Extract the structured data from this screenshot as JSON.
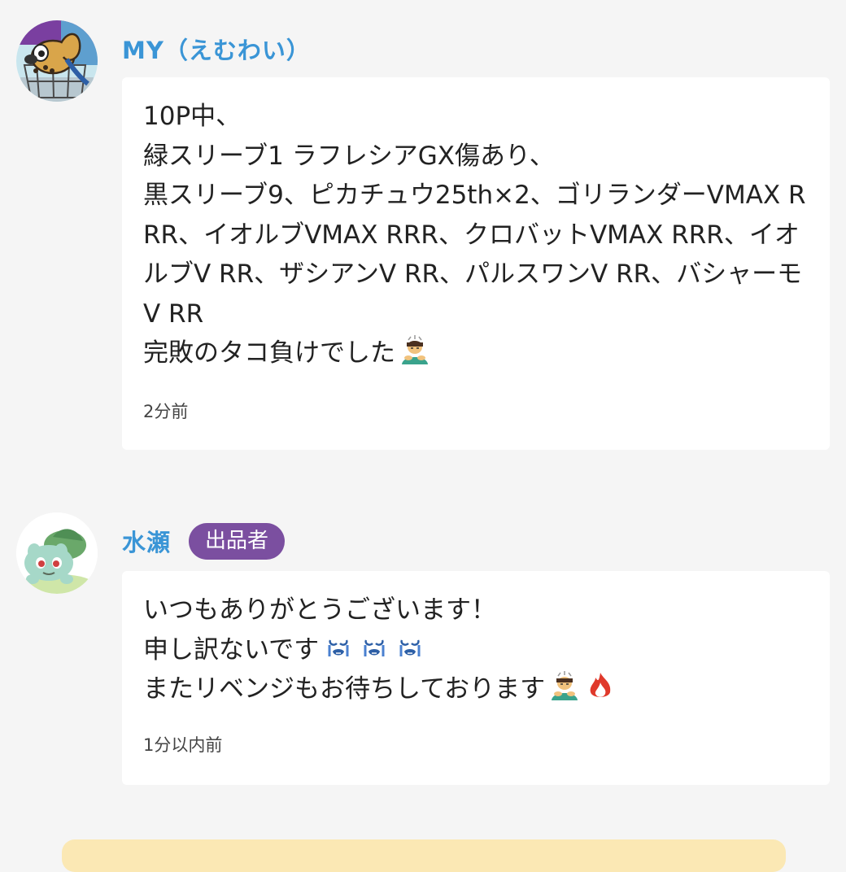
{
  "comments": [
    {
      "username": "MY（えむわい）",
      "avatar_icon": "cartoon-dog-in-cart-avatar",
      "message": "10P中、\n緑スリーブ1 ラフレシアGX傷あり、\n黒スリーブ9、ピカチュウ25th×2、ゴリランダーVMAX RRR、イオルブVMAX RRR、クロバットVMAX RRR、イオルブV RR、ザシアンV RR、パルスワンV RR、バシャーモV RR\n完敗のタコ負けでした",
      "message_emoji": [
        "person-bowing-emoji"
      ],
      "time": "2分前"
    },
    {
      "username": "水瀬",
      "badge": "出品者",
      "avatar_icon": "bulbasaur-avatar",
      "message_lines": [
        "いつもありがとうございます！",
        "申し訳ないです",
        "またリベンジもお待ちしております"
      ],
      "line2_emoji": [
        "crying-face-emoji",
        "crying-face-emoji",
        "crying-face-emoji"
      ],
      "line3_emoji": [
        "person-bowing-emoji",
        "fire-emoji"
      ],
      "time": "1分以内前"
    }
  ],
  "colors": {
    "background": "#f5f5f5",
    "username": "#3a95d6",
    "badge": "#7b4fa0",
    "banner": "#fbe8b4"
  }
}
